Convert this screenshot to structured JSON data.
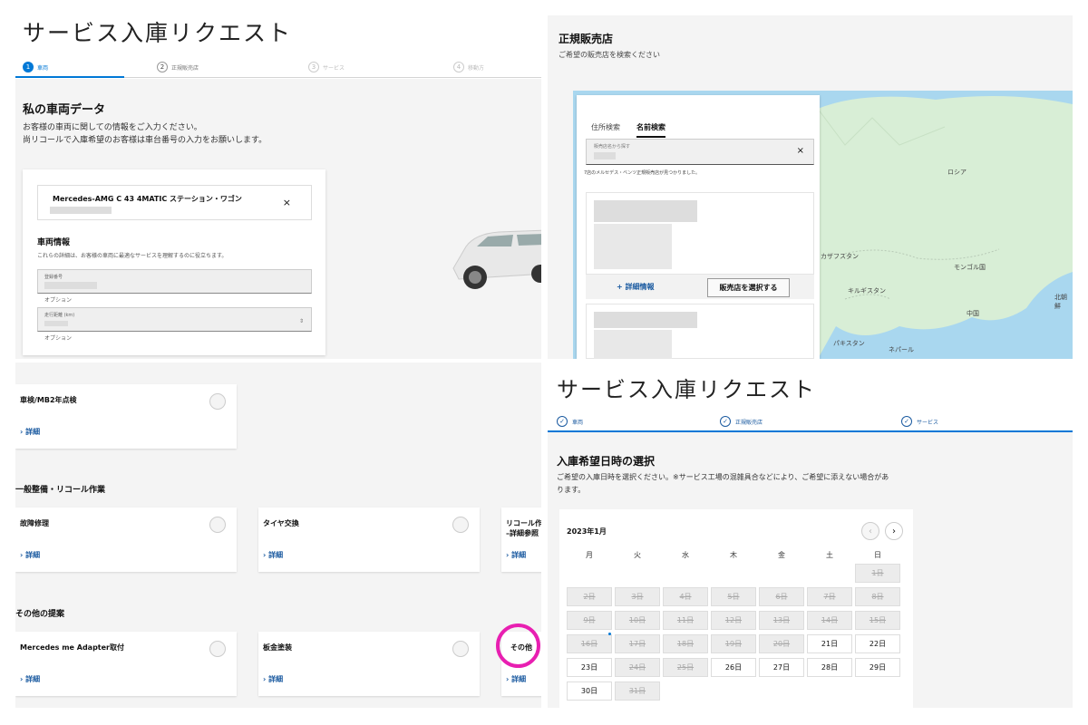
{
  "colors": {
    "accent": "#0078d6",
    "link": "#1a5aa0",
    "highlight_ring": "#e81fb1",
    "map_water": "#a9d7ef",
    "map_land": "#d8eed6"
  },
  "vehicle_page": {
    "title": "サービス入庫リクエスト",
    "steps": [
      {
        "num": "1",
        "label": "車両",
        "state": "active"
      },
      {
        "num": "2",
        "label": "正規販売店",
        "state": "pending"
      },
      {
        "num": "3",
        "label": "サービス",
        "state": "disabled"
      },
      {
        "num": "4",
        "label": "移動方",
        "state": "disabled"
      }
    ],
    "heading": "私の車両データ",
    "desc_line1": "お客様の車両に関しての情報をご入力ください。",
    "desc_line2": "尚リコールで入庫希望のお客様は車台番号の入力をお願いします。",
    "vehicle_name": "Mercedes-AMG C 43 4MATIC ステーション・ワゴン",
    "close": "×",
    "info_title": "車両情報",
    "info_desc": "これらの詳細は、お客様の車両に最適なサービスを理解するのに役立ちます。",
    "reg_label": "登録番号",
    "reg_note": "オプション",
    "mileage_label": "走行距離 (km)",
    "mileage_note": "オプション"
  },
  "dealer_page": {
    "title": "正規販売店",
    "subtitle": "ご希望の販売店を検索ください",
    "tabs": [
      {
        "label": "住所検索",
        "active": false
      },
      {
        "label": "名前検索",
        "active": true
      }
    ],
    "search_placeholder": "販売店名から探す",
    "clear": "×",
    "result_text": "7店のメルセデス・ベンツ正規販売店が見つかりました。",
    "more_info": "+ 詳細情報",
    "select_button": "販売店を選択する",
    "map_labels": [
      "ロシア",
      "カザフスタン",
      "モンゴル国",
      "キルギスタン",
      "中国",
      "北朝鮮",
      "パキスタン",
      "ネパール"
    ]
  },
  "services_page": {
    "sections": [
      "一般整備・リコール作業",
      "その他の提案"
    ],
    "detail": "詳細",
    "chevron": "›",
    "row1": [
      {
        "name": "車検/MB2年点検"
      }
    ],
    "row2": [
      {
        "name": "故障修理"
      },
      {
        "name": "タイヤ交換"
      },
      {
        "name": "リコール作\n–詳細参照"
      }
    ],
    "row3": [
      {
        "name": "Mercedes me Adapter取付"
      },
      {
        "name": "板金塗装"
      },
      {
        "name": "その他"
      }
    ]
  },
  "calendar_page": {
    "title": "サービス入庫リクエスト",
    "steps": [
      {
        "label": "車両"
      },
      {
        "label": "正規販売店"
      },
      {
        "label": "サービス"
      }
    ],
    "check": "✓",
    "heading": "入庫希望日時の選択",
    "desc": "ご希望の入庫日時を選択ください。※サービス工場の混雑具合などにより、ご希望に添えない場合があります。",
    "month": "2023年1月",
    "prev": "‹",
    "next": "›",
    "weekdays": [
      "月",
      "火",
      "水",
      "木",
      "金",
      "土",
      "日"
    ],
    "days": [
      {
        "label": "1日",
        "available": false
      },
      {
        "label": "2日",
        "available": false
      },
      {
        "label": "3日",
        "available": false
      },
      {
        "label": "4日",
        "available": false
      },
      {
        "label": "5日",
        "available": false
      },
      {
        "label": "6日",
        "available": false
      },
      {
        "label": "7日",
        "available": false
      },
      {
        "label": "8日",
        "available": false
      },
      {
        "label": "9日",
        "available": false
      },
      {
        "label": "10日",
        "available": false
      },
      {
        "label": "11日",
        "available": false
      },
      {
        "label": "12日",
        "available": false
      },
      {
        "label": "13日",
        "available": false
      },
      {
        "label": "14日",
        "available": false
      },
      {
        "label": "15日",
        "available": false
      },
      {
        "label": "16日",
        "available": false,
        "today": true
      },
      {
        "label": "17日",
        "available": false
      },
      {
        "label": "18日",
        "available": false
      },
      {
        "label": "19日",
        "available": false
      },
      {
        "label": "20日",
        "available": false
      },
      {
        "label": "21日",
        "available": true
      },
      {
        "label": "22日",
        "available": true
      },
      {
        "label": "23日",
        "available": true
      },
      {
        "label": "24日",
        "available": false
      },
      {
        "label": "25日",
        "available": false
      },
      {
        "label": "26日",
        "available": true
      },
      {
        "label": "27日",
        "available": true
      },
      {
        "label": "28日",
        "available": true
      },
      {
        "label": "29日",
        "available": true
      },
      {
        "label": "30日",
        "available": true
      },
      {
        "label": "31日",
        "available": false
      }
    ]
  }
}
